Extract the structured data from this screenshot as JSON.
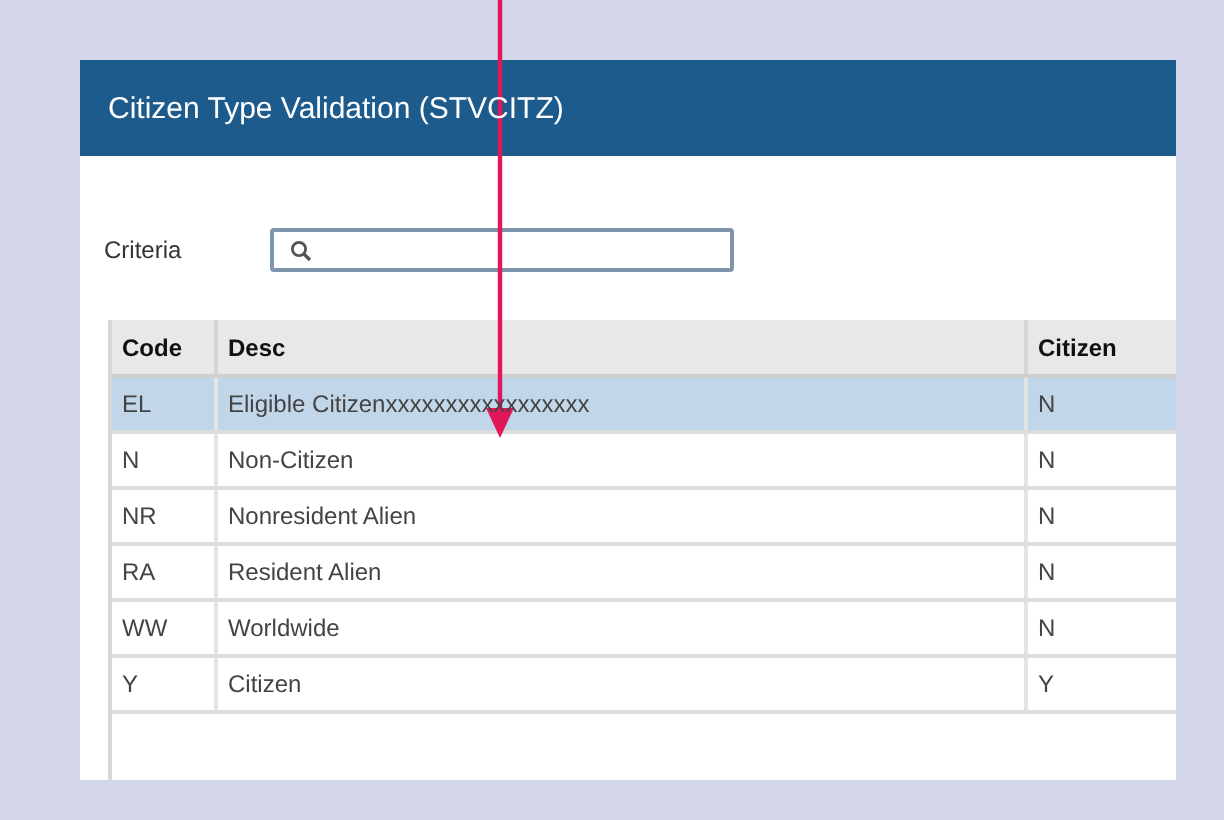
{
  "window": {
    "title": "Citizen Type Validation (STVCITZ)"
  },
  "criteria": {
    "label": "Criteria"
  },
  "table": {
    "columns": [
      "Code",
      "Desc",
      "Citizen"
    ],
    "rows": [
      {
        "cells": [
          "EL",
          "Eligible Citizenxxxxxxxxxxxxxxxxx",
          "N"
        ],
        "selected": true
      },
      {
        "cells": [
          "N",
          "Non-Citizen",
          "N"
        ],
        "selected": false
      },
      {
        "cells": [
          "NR",
          "Nonresident Alien",
          "N"
        ],
        "selected": false
      },
      {
        "cells": [
          "RA",
          "Resident Alien",
          "N"
        ],
        "selected": false
      },
      {
        "cells": [
          "WW",
          "Worldwide",
          "N"
        ],
        "selected": false
      },
      {
        "cells": [
          "Y",
          "Citizen",
          "Y"
        ],
        "selected": false
      }
    ]
  }
}
